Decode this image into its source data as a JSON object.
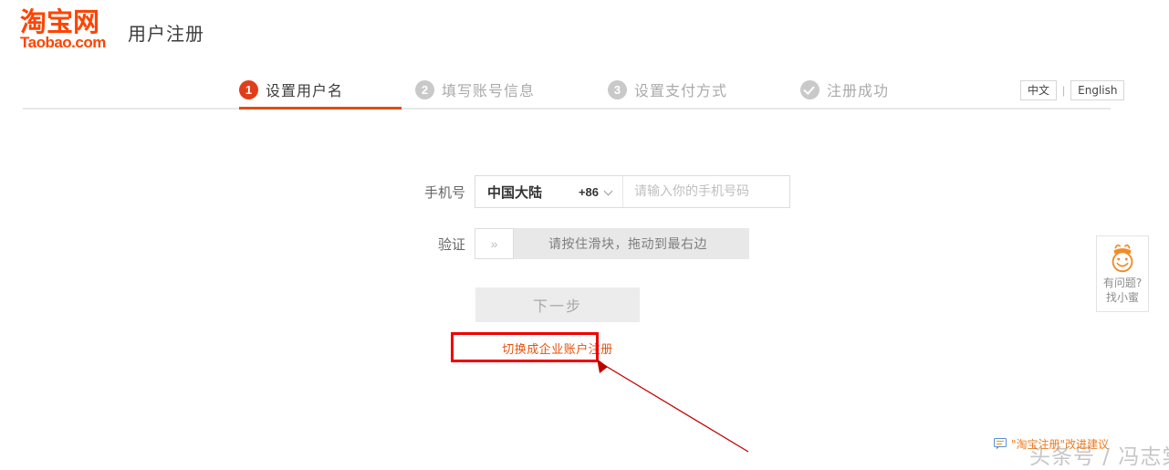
{
  "header": {
    "logo_cn": "淘宝网",
    "logo_en": "Taobao.com",
    "page_title": "用户注册",
    "logo_color": "#ff4400"
  },
  "language": {
    "chinese_label": "中文",
    "separator": "|",
    "english_label": "English"
  },
  "steps": [
    {
      "num": "1",
      "label": "设置用户名",
      "state": "active"
    },
    {
      "num": "2",
      "label": "填写账号信息",
      "state": "inactive"
    },
    {
      "num": "3",
      "label": "设置支付方式",
      "state": "inactive"
    },
    {
      "num": "✓",
      "label": "注册成功",
      "state": "inactive"
    }
  ],
  "form": {
    "phone": {
      "label": "手机号",
      "country_name": "中国大陆",
      "country_code": "+86",
      "input_value": "",
      "placeholder": "请输入你的手机号码"
    },
    "captcha": {
      "label": "验证",
      "handle_glyph": "»",
      "hint": "请按住滑块，拖动到最右边"
    },
    "next_button": "下一步",
    "enterprise_link": "切换成企业账户注册"
  },
  "help_widget": {
    "icon": "honeybee-mascot-icon",
    "line1": "有问题?",
    "line2": "找小蜜"
  },
  "feedback": {
    "icon": "feedback-note-icon",
    "text": "\"淘宝注册\"改进建议"
  },
  "watermark": {
    "text": "头条号 / 冯志棠"
  },
  "annotation": {
    "box_color": "#ef0000",
    "arrow_color": "#c00000"
  }
}
